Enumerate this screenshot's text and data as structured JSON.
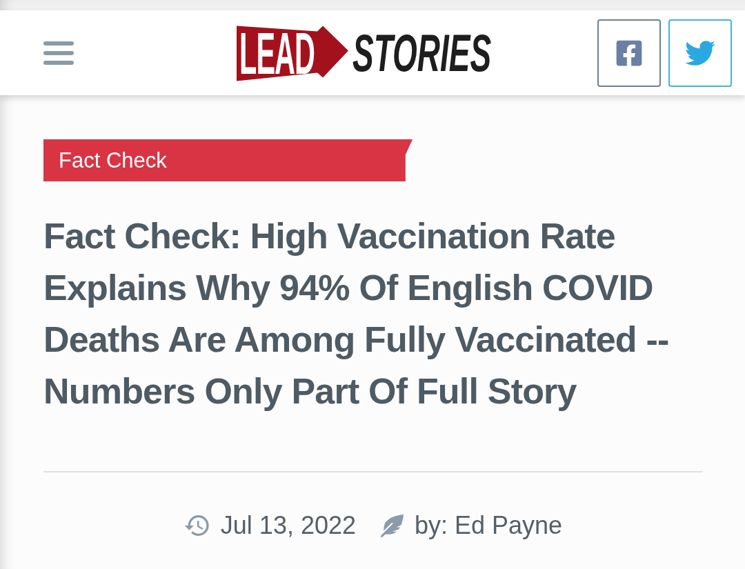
{
  "header": {
    "logo": {
      "lead": "LEAD",
      "stories": "STORIES"
    }
  },
  "article": {
    "category": "Fact Check",
    "title": "Fact Check: High Vaccination Rate Explains Why 94% Of English COVID Deaths Are Among Fully Vaccinated -- Numbers Only Part Of Full Story",
    "date": "Jul 13, 2022",
    "author": "by: Ed Payne"
  }
}
